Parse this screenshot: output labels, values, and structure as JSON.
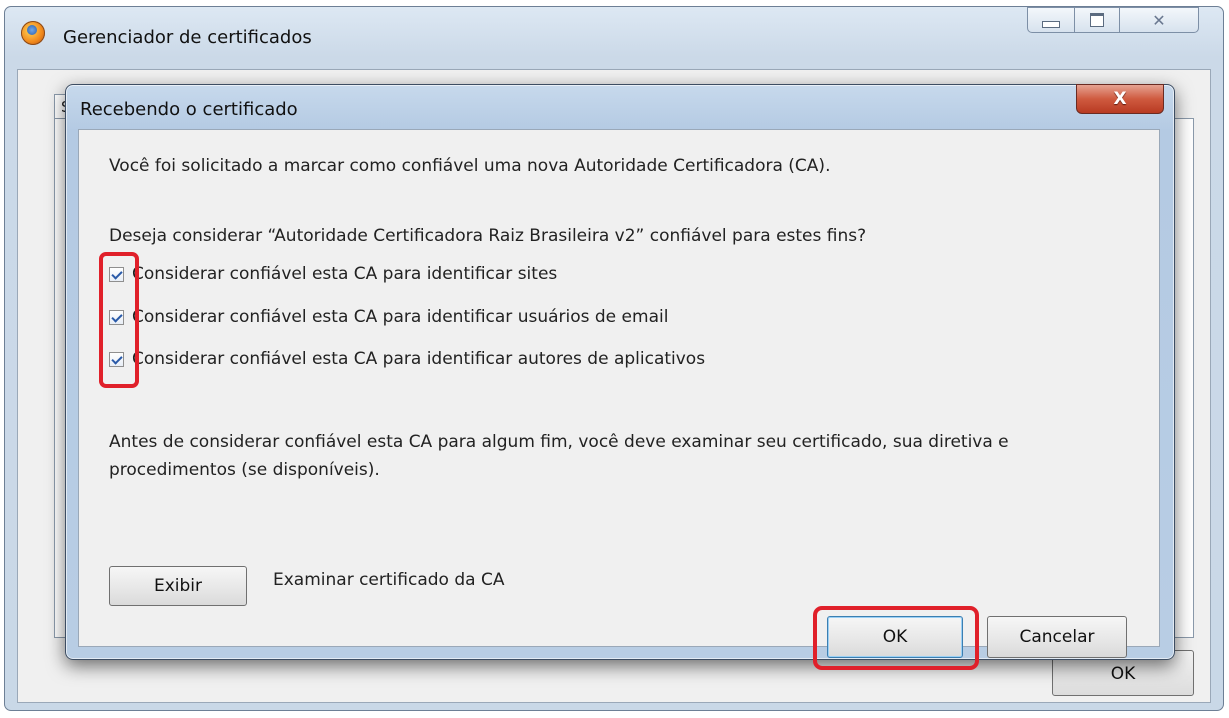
{
  "parent_window": {
    "title": "Gerenciador de certificados",
    "tab_fragment": "S",
    "ok_label": "OK"
  },
  "dialog": {
    "title": "Recebendo o certificado",
    "close_glyph": "X",
    "intro": "Você foi solicitado a marcar como confiável uma nova Autoridade Certificadora (CA).",
    "question": "Deseja considerar “Autoridade Certificadora Raiz Brasileira v2” confiável para estes fins?",
    "checkboxes": [
      {
        "label": "Considerar confiável esta CA para identificar sites",
        "checked": true
      },
      {
        "label": "Considerar confiável esta CA para identificar usuários de email",
        "checked": true
      },
      {
        "label": "Considerar confiável esta CA para identificar autores de aplicativos",
        "checked": true
      }
    ],
    "warning": "Antes de considerar confiável esta CA para algum fim, você deve examinar seu certificado, sua diretiva e procedimentos (se disponíveis).",
    "view_button": "Exibir",
    "view_description": "Examinar certificado da CA",
    "ok_button": "OK",
    "cancel_button": "Cancelar"
  },
  "colors": {
    "highlight": "#e0202a",
    "dialog_frame": "#b4cae3",
    "body_bg": "#f0f0f0"
  }
}
